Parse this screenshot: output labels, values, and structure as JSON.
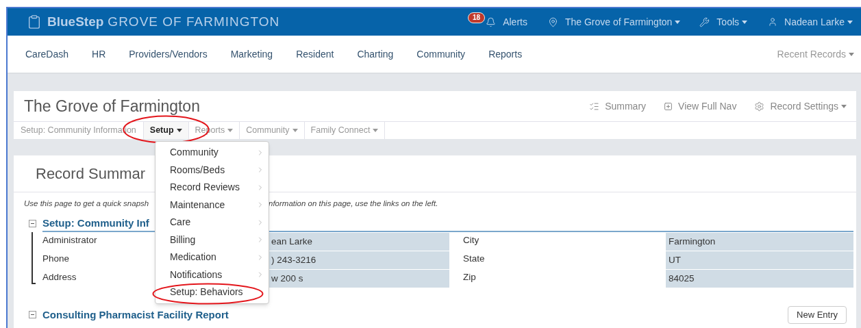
{
  "header": {
    "brand": "BlueStep",
    "site": "GROVE OF FARMINGTON",
    "alerts": {
      "count": "18",
      "label": "Alerts"
    },
    "location": "The Grove of Farmington",
    "tools": "Tools",
    "user": "Nadean Larke"
  },
  "nav": {
    "items": [
      "CareDash",
      "HR",
      "Providers/Vendors",
      "Marketing",
      "Resident",
      "Charting",
      "Community",
      "Reports"
    ],
    "recent": "Recent Records"
  },
  "record": {
    "title": "The Grove of Farmington",
    "actions": [
      {
        "kind": "summary",
        "label": "Summary"
      },
      {
        "kind": "fullnav",
        "label": "View Full Nav"
      },
      {
        "kind": "settings",
        "label": "Record Settings"
      }
    ],
    "tabs": [
      {
        "kind": "label",
        "label": "Setup: Community Information"
      },
      {
        "kind": "dropdown",
        "label": "Setup",
        "expanded": true
      },
      {
        "kind": "dropdown",
        "label": "Reports",
        "expanded": false
      },
      {
        "kind": "dropdown",
        "label": "Community",
        "expanded": false
      },
      {
        "kind": "dropdown",
        "label": "Family Connect",
        "expanded": false
      }
    ]
  },
  "menu": [
    {
      "label": "Community",
      "submenu": true
    },
    {
      "label": "Rooms/Beds",
      "submenu": true
    },
    {
      "label": "Record Reviews",
      "submenu": true
    },
    {
      "label": "Maintenance",
      "submenu": true
    },
    {
      "label": "Care",
      "submenu": true
    },
    {
      "label": "Billing",
      "submenu": true
    },
    {
      "label": "Medication",
      "submenu": true
    },
    {
      "label": "Notifications",
      "submenu": true
    },
    {
      "label": "Setup: Behaviors",
      "submenu": false
    }
  ],
  "summary": {
    "heading": "Record Summar",
    "description": [
      "Use this page to get a quick snapsh",
      "nformation on this page, use the links on the left."
    ],
    "section": {
      "title": "Setup: Community Inf",
      "rows": [
        {
          "fields": [
            {
              "label": "Administrator",
              "value": "ean Larke"
            },
            {
              "label": "City",
              "value": "Farmington"
            }
          ]
        },
        {
          "fields": [
            {
              "label": "Phone",
              "value": ") 243-3216"
            },
            {
              "label": "State",
              "value": "UT"
            }
          ]
        },
        {
          "fields": [
            {
              "label": "Address",
              "value": "w 200 s"
            },
            {
              "label": "Zip",
              "value": "84025"
            }
          ]
        }
      ]
    },
    "next_section": "Consulting Pharmacist Facility Report",
    "new_entry": "New Entry"
  }
}
